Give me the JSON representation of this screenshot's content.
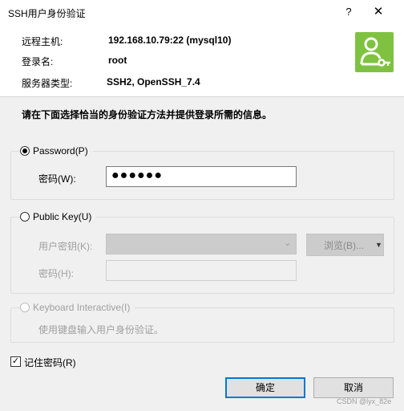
{
  "window": {
    "title": "SSH用户身份验证",
    "help_glyph": "?",
    "close_glyph": "✕"
  },
  "info": {
    "host_label": "远程主机:",
    "host_value": "192.168.10.79:22 (mysql10)",
    "login_label": "登录名:",
    "login_value": "root",
    "server_type_label": "服务器类型:",
    "server_type_value": "SSH2, OpenSSH_7.4",
    "icon": "user-key-icon",
    "icon_color": "#7fc241"
  },
  "instruction": "请在下面选择恰当的身份验证方法并提供登录所需的信息。",
  "password_method": {
    "label": "Password(P)",
    "selected": true,
    "field_label": "密码(W):",
    "field_value": "●●●●●●"
  },
  "public_key_method": {
    "label": "Public Key(U)",
    "selected": false,
    "user_key_label": "用户密钥(K):",
    "user_key_value": "",
    "browse_label": "浏览(B)...",
    "passphrase_label": "密码(H):",
    "passphrase_value": ""
  },
  "keyboard_method": {
    "label": "Keyboard Interactive(I)",
    "selected": false,
    "enabled": false,
    "description": "使用键盘输入用户身份验证。"
  },
  "remember": {
    "label": "记住密码(R)",
    "checked": true,
    "check_glyph": "✓"
  },
  "buttons": {
    "ok": "确定",
    "cancel": "取消"
  },
  "watermark": "CSDN @lyx_82e",
  "colors": {
    "accent": "#0078d7",
    "icon_green": "#7fc241"
  }
}
